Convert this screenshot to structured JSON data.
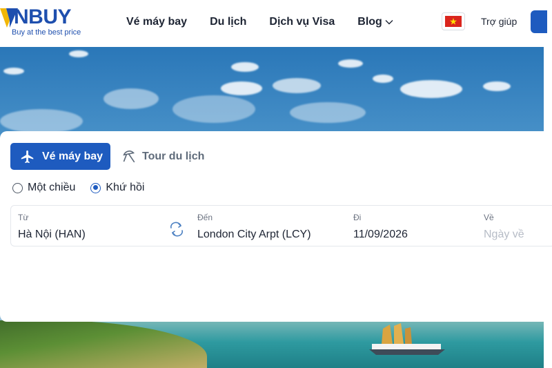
{
  "header": {
    "logo_text": "NBUY",
    "logo_tagline": "Buy at the best price",
    "nav": [
      {
        "label": "Vé máy bay"
      },
      {
        "label": "Du lịch"
      },
      {
        "label": "Dịch vụ Visa"
      },
      {
        "label": "Blog",
        "has_dropdown": true
      }
    ],
    "language_flag": "vietnam-flag-icon",
    "help_label": "Trợ giúp"
  },
  "search": {
    "tabs": [
      {
        "label": "Vé máy bay",
        "icon": "airplane-icon",
        "active": true
      },
      {
        "label": "Tour du lịch",
        "icon": "umbrella-icon",
        "active": false
      }
    ],
    "trip_types": [
      {
        "label": "Một chiều",
        "selected": false
      },
      {
        "label": "Khứ hồi",
        "selected": true
      }
    ],
    "fields": {
      "from": {
        "label": "Từ",
        "value": "Hà Nội (HAN)"
      },
      "to": {
        "label": "Đến",
        "value": "London City Arpt (LCY)"
      },
      "depart": {
        "label": "Đi",
        "value": "11/09/2026"
      },
      "return": {
        "label": "Về",
        "placeholder": "Ngày về"
      }
    }
  },
  "colors": {
    "brand": "#1e5bbf",
    "logo": "#1e4fae",
    "accent_yellow": "#f2b707"
  }
}
